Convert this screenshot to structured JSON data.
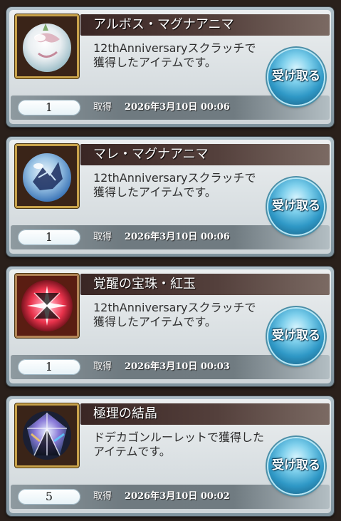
{
  "items": [
    {
      "name": "アルボス・マグナアニマ",
      "description": "12thAnniversaryスクラッチで獲得したアイテムです。",
      "quantity": "1",
      "acquired_label": "取得",
      "acquired_at": "2026年3月10日 00:06",
      "button_label": "受け取る",
      "icon": "white-crystal-orb-icon",
      "icon_colors": [
        "#f4f6f8",
        "#d9a6b4",
        "#9fbfc9"
      ]
    },
    {
      "name": "マレ・マグナアニマ",
      "description": "12thAnniversaryスクラッチで獲得したアイテムです。",
      "quantity": "1",
      "acquired_label": "取得",
      "acquired_at": "2026年3月10日 00:06",
      "button_label": "受け取る",
      "icon": "blue-crystal-orb-icon",
      "icon_colors": [
        "#cfe6f7",
        "#3e77b8",
        "#1b2d5e"
      ]
    },
    {
      "name": "覚醒の宝珠・紅玉",
      "description": "12thAnniversaryスクラッチで獲得したアイテムです。",
      "quantity": "1",
      "acquired_label": "取得",
      "acquired_at": "2026年3月10日 00:03",
      "button_label": "受け取る",
      "icon": "red-awakening-orb-icon",
      "icon_colors": [
        "#ffffff",
        "#e8324b",
        "#5a0b12"
      ]
    },
    {
      "name": "極理の結晶",
      "description": "ドデカゴンルーレットで獲得したアイテムです。",
      "quantity": "5",
      "acquired_label": "取得",
      "acquired_at": "2026年3月10日 00:02",
      "button_label": "受け取る",
      "icon": "prism-crystal-icon",
      "icon_colors": [
        "#e9f2ff",
        "#8a7ad8",
        "#2a3f6a"
      ]
    }
  ]
}
